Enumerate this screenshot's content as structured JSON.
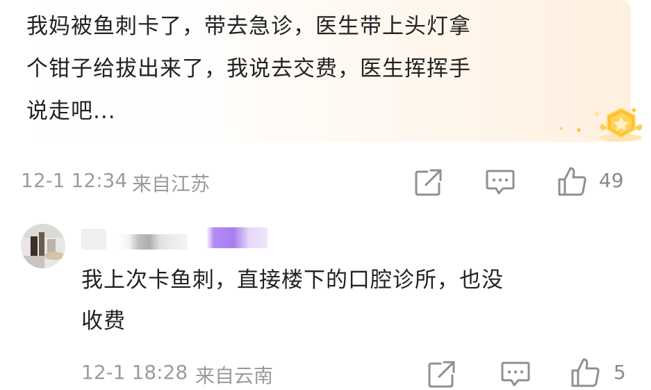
{
  "comments": [
    {
      "text": "我妈被鱼刺卡了，带去急诊，医生带上头灯拿\n个钳子给拔出来了，我说去交费，医生挥挥手\n说走吧...",
      "timestamp": "12-1 12:34",
      "location": "来自江苏",
      "likes": "49"
    },
    {
      "text": "我上次卡鱼刺，直接楼下的口腔诊所，也没\n收费",
      "timestamp": "12-1 18:28",
      "location": "来自云南",
      "likes": "5"
    }
  ],
  "colors": {
    "text": "#222222",
    "meta": "#9b9b9b",
    "icon": "#8f8f8f",
    "badge_gold": "#ffc63d",
    "tag_purple": "#a77ff0"
  },
  "icons": [
    "share-icon",
    "comment-icon",
    "like-icon",
    "medal-badge-icon"
  ]
}
